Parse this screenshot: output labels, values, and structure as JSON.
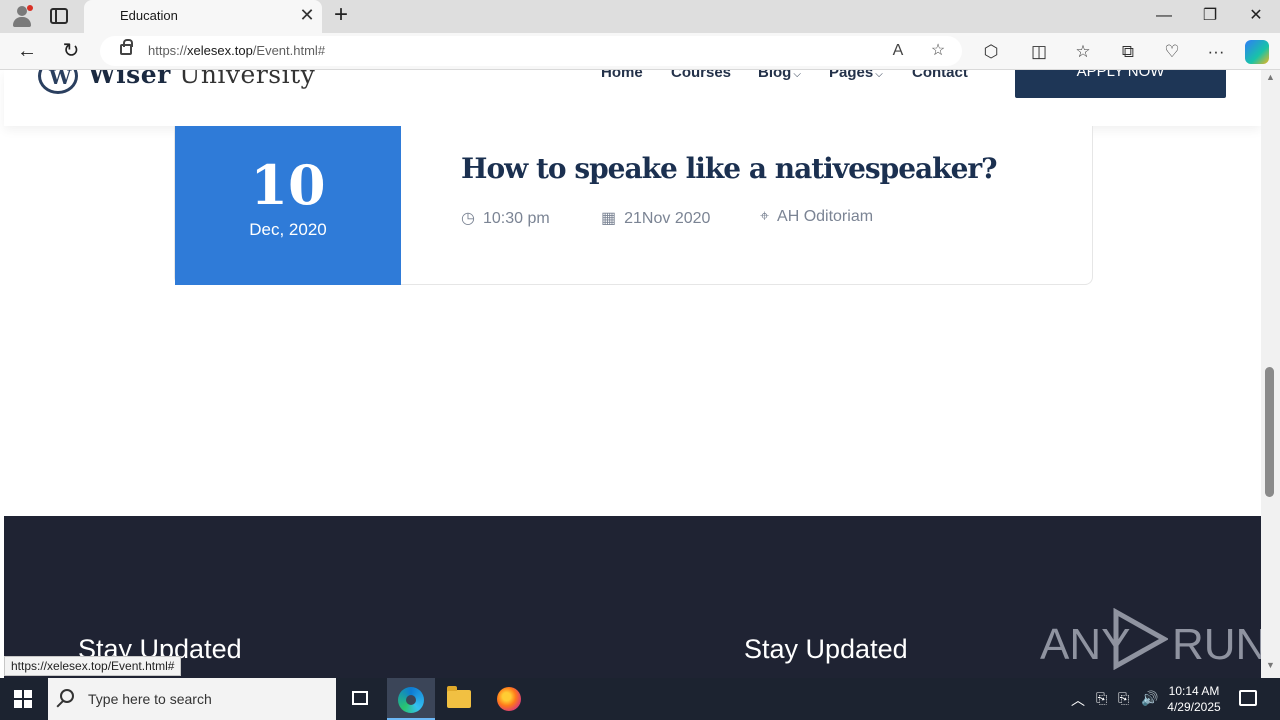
{
  "browser": {
    "tab_title": "Education",
    "tab_close": "✕",
    "new_tab": "+",
    "url_prefix": "https://",
    "url_host": "xelesex.top",
    "url_path": "/Event.html#",
    "window_controls": {
      "minimize": "—",
      "restore": "❐",
      "close": "✕"
    },
    "status_tooltip": "https://xelesex.top/Event.html#"
  },
  "site": {
    "logo_emblem": "W",
    "logo_bold": "Wiser",
    "logo_rest": " University",
    "nav": {
      "home": "Home",
      "courses": "Courses",
      "blog": "Blog",
      "pages": "Pages",
      "contact": "Contact"
    },
    "apply_button": "APPLY NOW"
  },
  "event": {
    "day": "10",
    "month_year": "Dec, 2020",
    "title": "How to speake like a nativespeaker?",
    "time": "10:30 pm",
    "date": "21Nov 2020",
    "location": "AH Oditoriam"
  },
  "footer": {
    "heading_left": "Stay Updated",
    "heading_right": "Stay Updated"
  },
  "watermark": {
    "left": "ANY",
    "right": "RUN"
  },
  "taskbar": {
    "search_placeholder": "Type here to search",
    "time": "10:14 AM",
    "date": "4/29/2025"
  },
  "icons": {
    "back": "←",
    "refresh": "↻",
    "read_aloud": "A",
    "favorite": "☆",
    "extensions": "⬡",
    "split": "◫",
    "favorites": "☆",
    "collections": "⧉",
    "performance": "♡",
    "more": "···",
    "clock": "◷",
    "calendar": "▦",
    "pin": "⌖",
    "caret": "⌵",
    "tray_up": "︿",
    "tray_net": "⎘",
    "tray_vol": "🔊"
  },
  "colors": {
    "accent_blue": "#2f7bd8",
    "navy": "#1e3656",
    "footer_bg": "#1f2333"
  }
}
